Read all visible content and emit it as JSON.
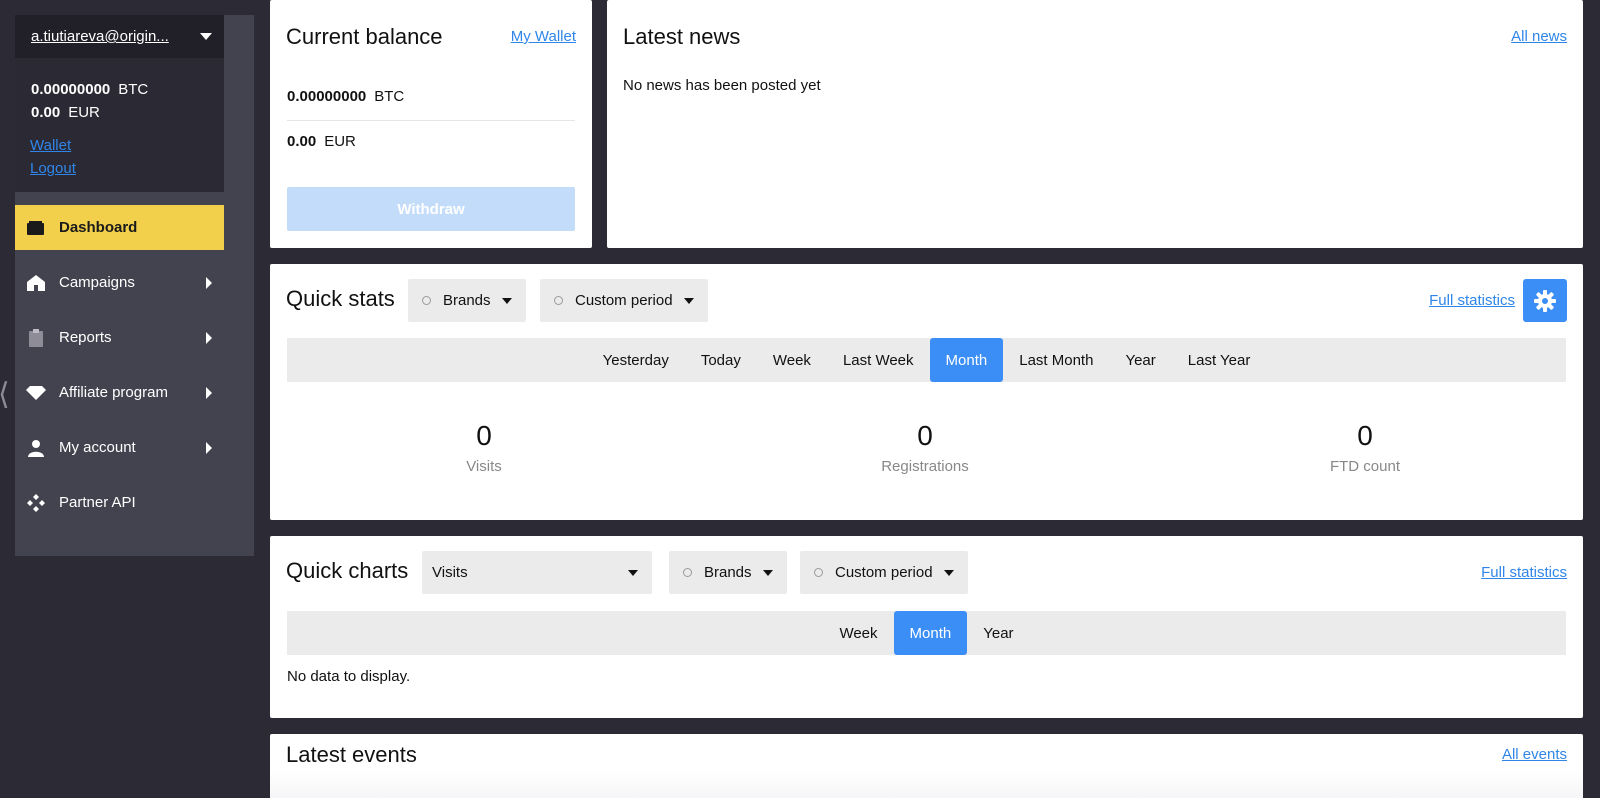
{
  "sidebar": {
    "account": {
      "email": "a.tiutiareva@origin...",
      "btc_amount": "0.00000000",
      "btc_currency": "BTC",
      "eur_amount": "0.00",
      "eur_currency": "EUR",
      "wallet_link": "Wallet",
      "logout_link": "Logout"
    },
    "items": [
      {
        "label": "Dashboard",
        "icon": "wallet-icon",
        "active": true
      },
      {
        "label": "Campaigns",
        "icon": "home-icon"
      },
      {
        "label": "Reports",
        "icon": "clipboard-icon"
      },
      {
        "label": "Affiliate program",
        "icon": "diamond-icon"
      },
      {
        "label": "My account",
        "icon": "user-icon"
      },
      {
        "label": "Partner API",
        "icon": "api-icon"
      }
    ],
    "collapse_glyph": "⟨"
  },
  "balance": {
    "title": "Current balance",
    "link": "My Wallet",
    "btc_amount": "0.00000000",
    "btc_currency": "BTC",
    "eur_amount": "0.00",
    "eur_currency": "EUR",
    "withdraw": "Withdraw"
  },
  "news": {
    "title": "Latest news",
    "link": "All news",
    "empty": "No news has been posted yet"
  },
  "quick_stats": {
    "title": "Quick stats",
    "brands": "Brands",
    "period": "Custom period",
    "link": "Full statistics",
    "tabs": [
      "Yesterday",
      "Today",
      "Week",
      "Last Week",
      "Month",
      "Last Month",
      "Year",
      "Last Year"
    ],
    "active_tab": "Month",
    "stats": [
      {
        "value": "0",
        "label": "Visits"
      },
      {
        "value": "0",
        "label": "Registrations"
      },
      {
        "value": "0",
        "label": "FTD count"
      }
    ]
  },
  "quick_charts": {
    "title": "Quick charts",
    "metric": "Visits",
    "brands": "Brands",
    "period": "Custom period",
    "link": "Full statistics",
    "tabs": [
      "Week",
      "Month",
      "Year"
    ],
    "active_tab": "Month",
    "empty": "No data to display."
  },
  "events": {
    "title": "Latest events",
    "link": "All events"
  },
  "colors": {
    "accent": "#3a8ef5",
    "active_nav": "#f2d04c",
    "background": "#2b2a35",
    "sidebar": "#43434f"
  }
}
